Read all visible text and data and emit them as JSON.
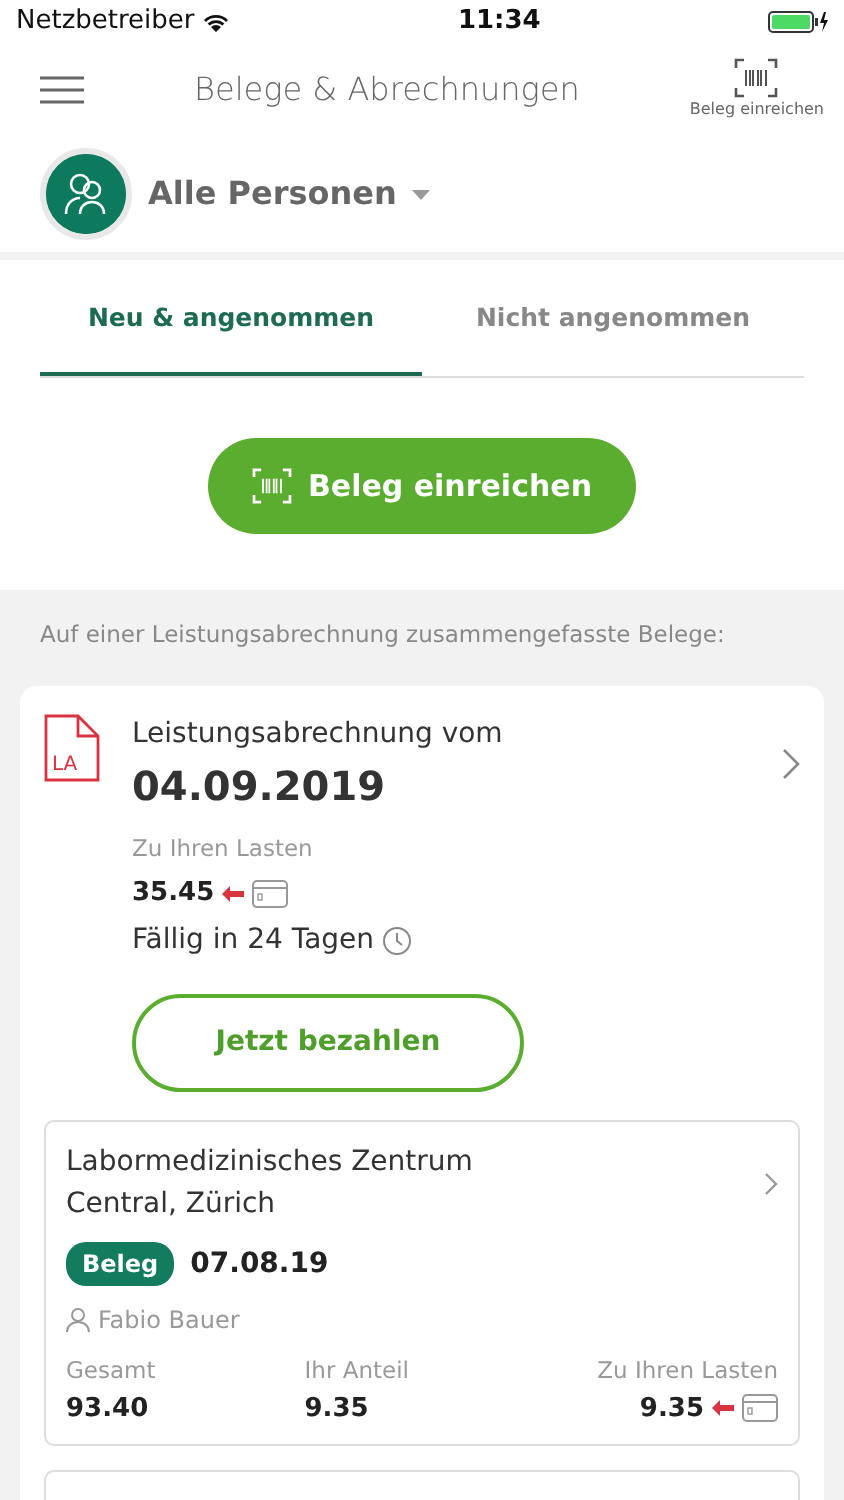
{
  "status_bar": {
    "carrier": "Netzbetreiber",
    "time": "11:34"
  },
  "header": {
    "title": "Belege & Abrechnungen",
    "action": "Beleg einreichen"
  },
  "person_selector": {
    "label": "Alle Personen"
  },
  "tabs": [
    {
      "label": "Neu & angenommen",
      "selected": true
    },
    {
      "label": "Nicht angenommen",
      "selected": false
    }
  ],
  "submit_button": "Beleg einreichen",
  "section_caption": "Auf einer Leistungsabrechnung zusammengefasste Belege:",
  "statement": {
    "icon_text": "LA",
    "title": "Leistungsabrechnung vom",
    "date": "04.09.2019",
    "charge_label": "Zu Ihren Lasten",
    "charge": "35.45",
    "due": "Fällig in 24 Tagen",
    "pay_button": "Jetzt bezahlen",
    "receipts": [
      {
        "provider": "Labormedizinisches Zentrum Central, Zürich",
        "tag": "Beleg",
        "date": "07.08.19",
        "person": "Fabio Bauer",
        "columns": [
          {
            "label": "Gesamt",
            "value": "93.40",
            "kind": "plain"
          },
          {
            "label": "Ihr Anteil",
            "value": "9.35",
            "kind": "plain"
          },
          {
            "label": "Zu Ihren Lasten",
            "value": "9.35",
            "kind": "charge"
          }
        ]
      }
    ]
  }
}
